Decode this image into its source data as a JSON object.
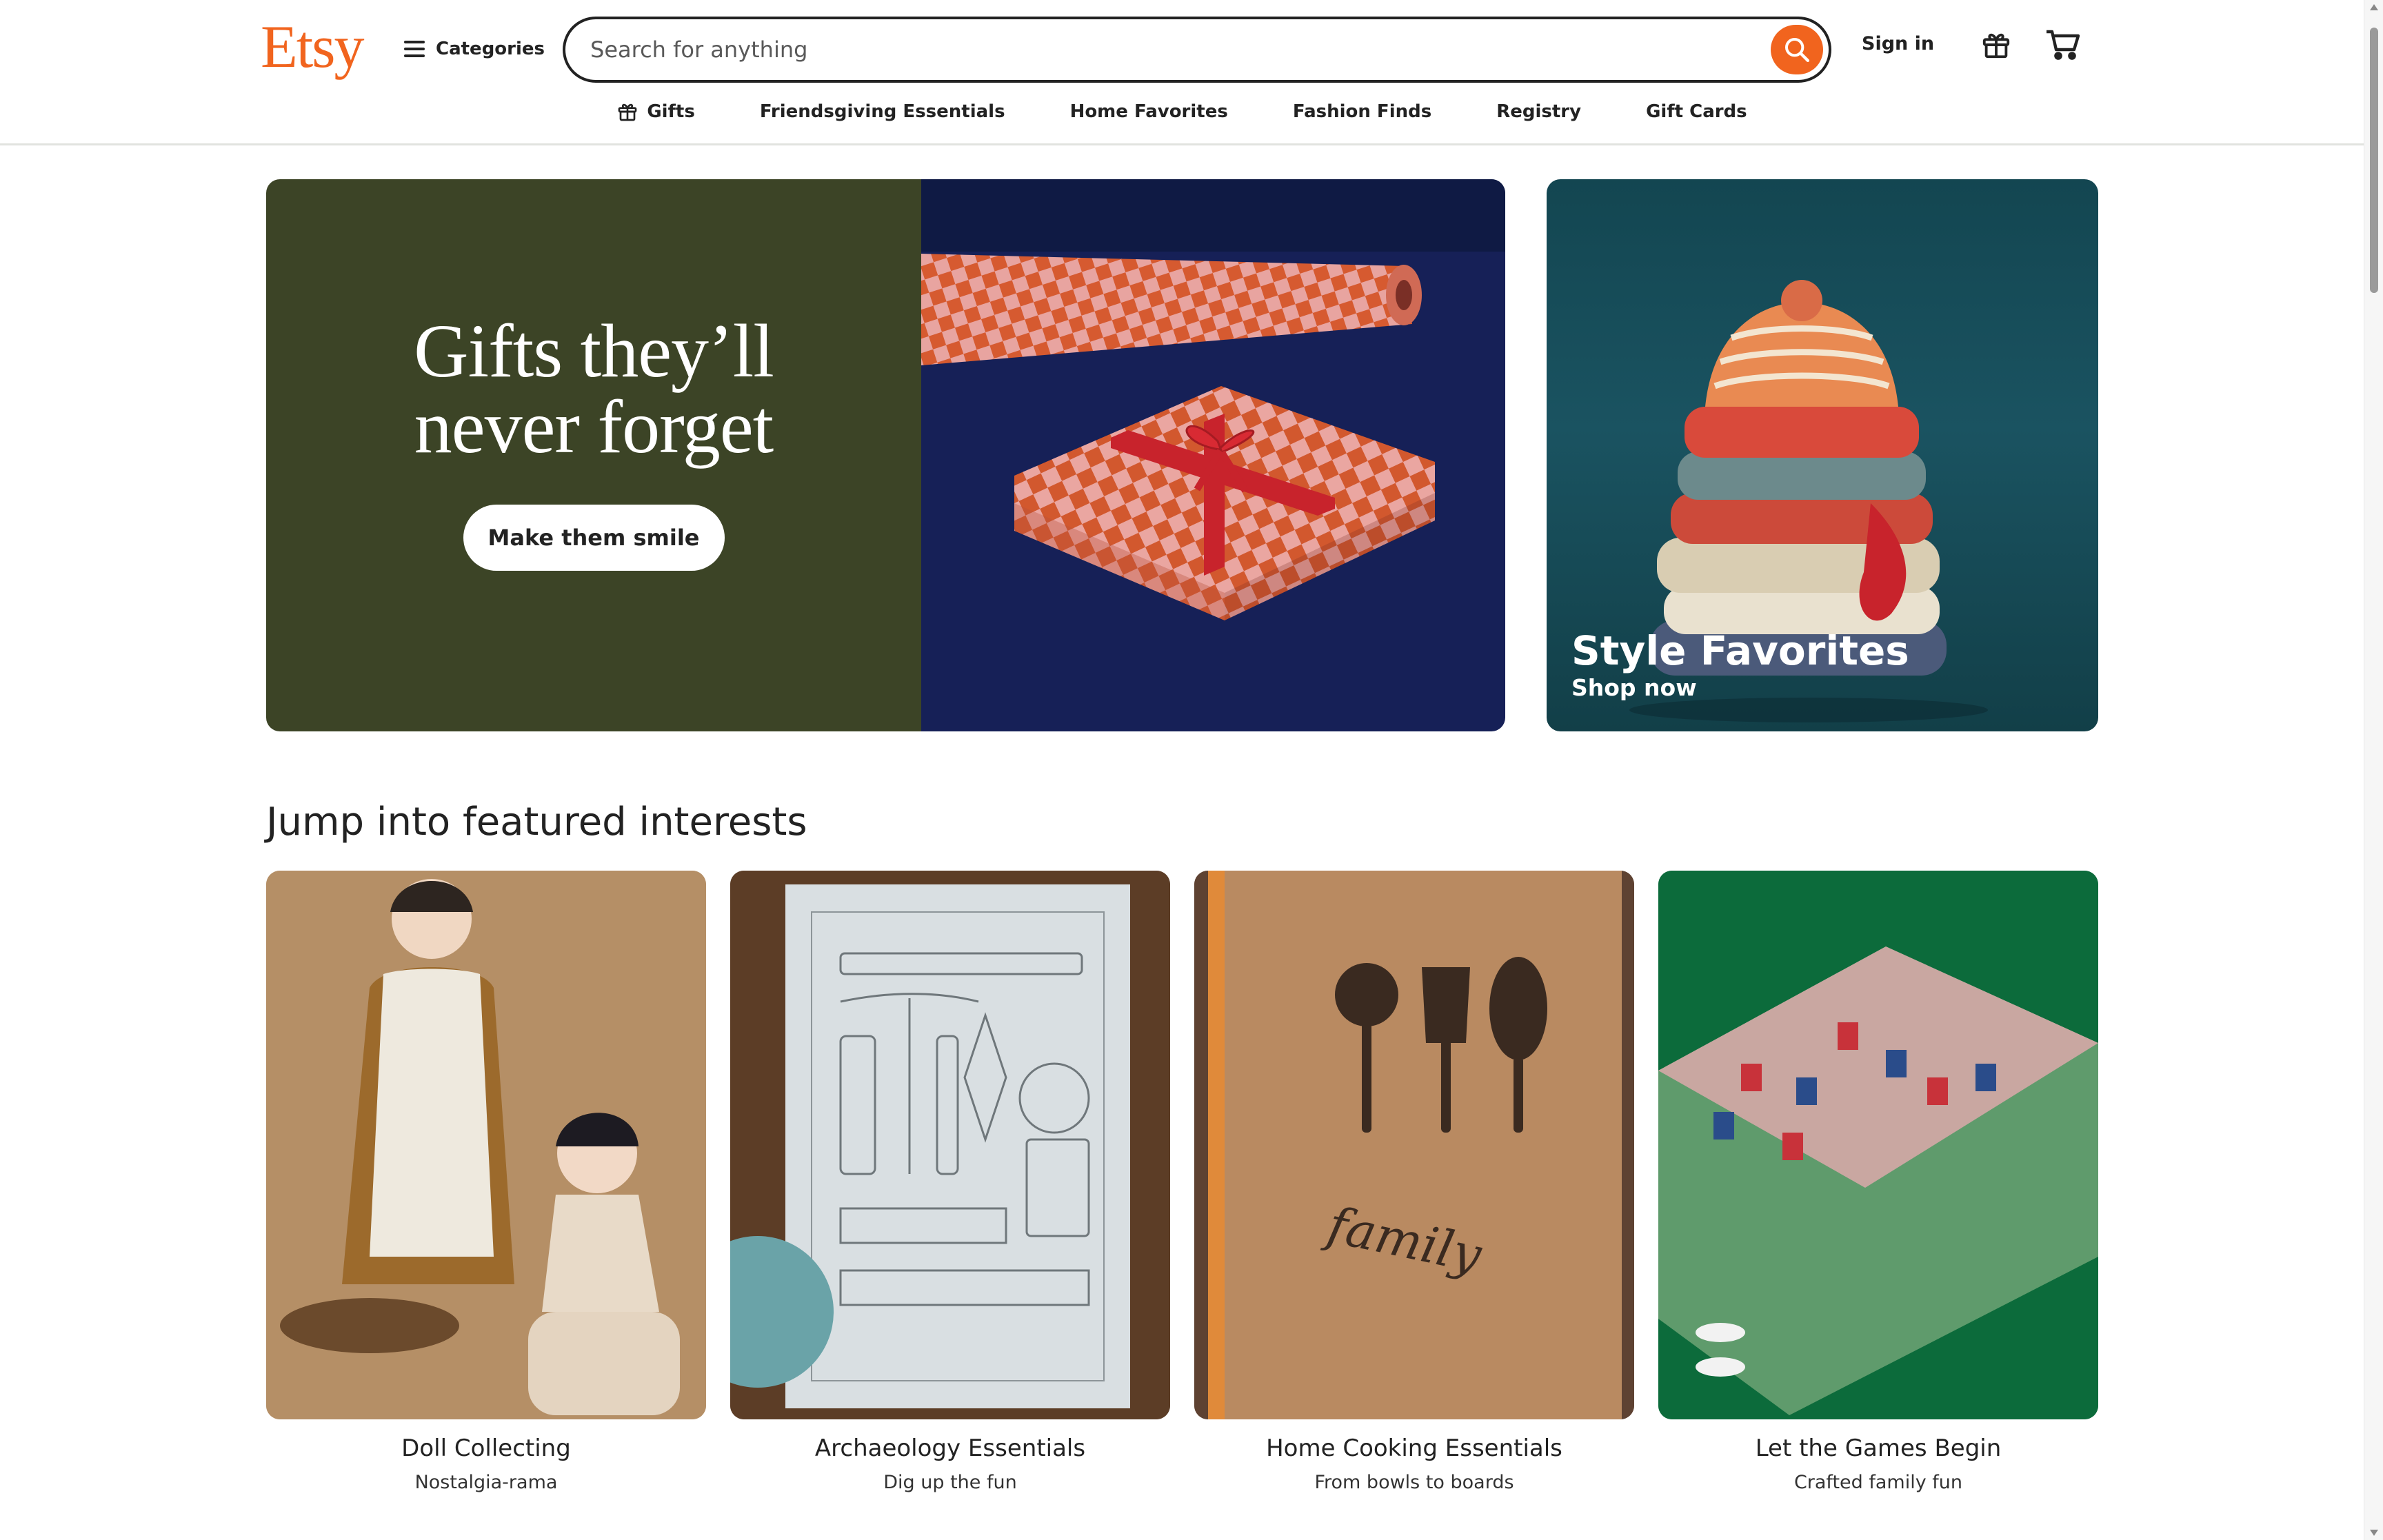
{
  "header": {
    "logo": "Etsy",
    "categories_label": "Categories",
    "search_placeholder": "Search for anything",
    "signin_label": "Sign in"
  },
  "nav": [
    {
      "label": "Gifts",
      "icon": "gift-icon"
    },
    {
      "label": "Friendsgiving Essentials"
    },
    {
      "label": "Home Favorites"
    },
    {
      "label": "Fashion Finds"
    },
    {
      "label": "Registry"
    },
    {
      "label": "Gift Cards"
    }
  ],
  "hero": {
    "title_line1": "Gifts they’ll",
    "title_line2": "never forget",
    "button_label": "Make them smile"
  },
  "promo": {
    "title": "Style Favorites",
    "subtitle": "Shop now"
  },
  "featured": {
    "heading": "Jump into featured interests",
    "cards": [
      {
        "title": "Doll Collecting",
        "subtitle": "Nostalgia-rama"
      },
      {
        "title": "Archaeology Essentials",
        "subtitle": "Dig up the fun"
      },
      {
        "title": "Home Cooking Essentials",
        "subtitle": "From bowls to boards"
      },
      {
        "title": "Let the Games Begin",
        "subtitle": "Crafted family fun"
      }
    ]
  },
  "colors": {
    "brand": "#f1641e",
    "hero_left": "#3c4426",
    "hero_right": "#162057",
    "promo": "#1a5361"
  }
}
